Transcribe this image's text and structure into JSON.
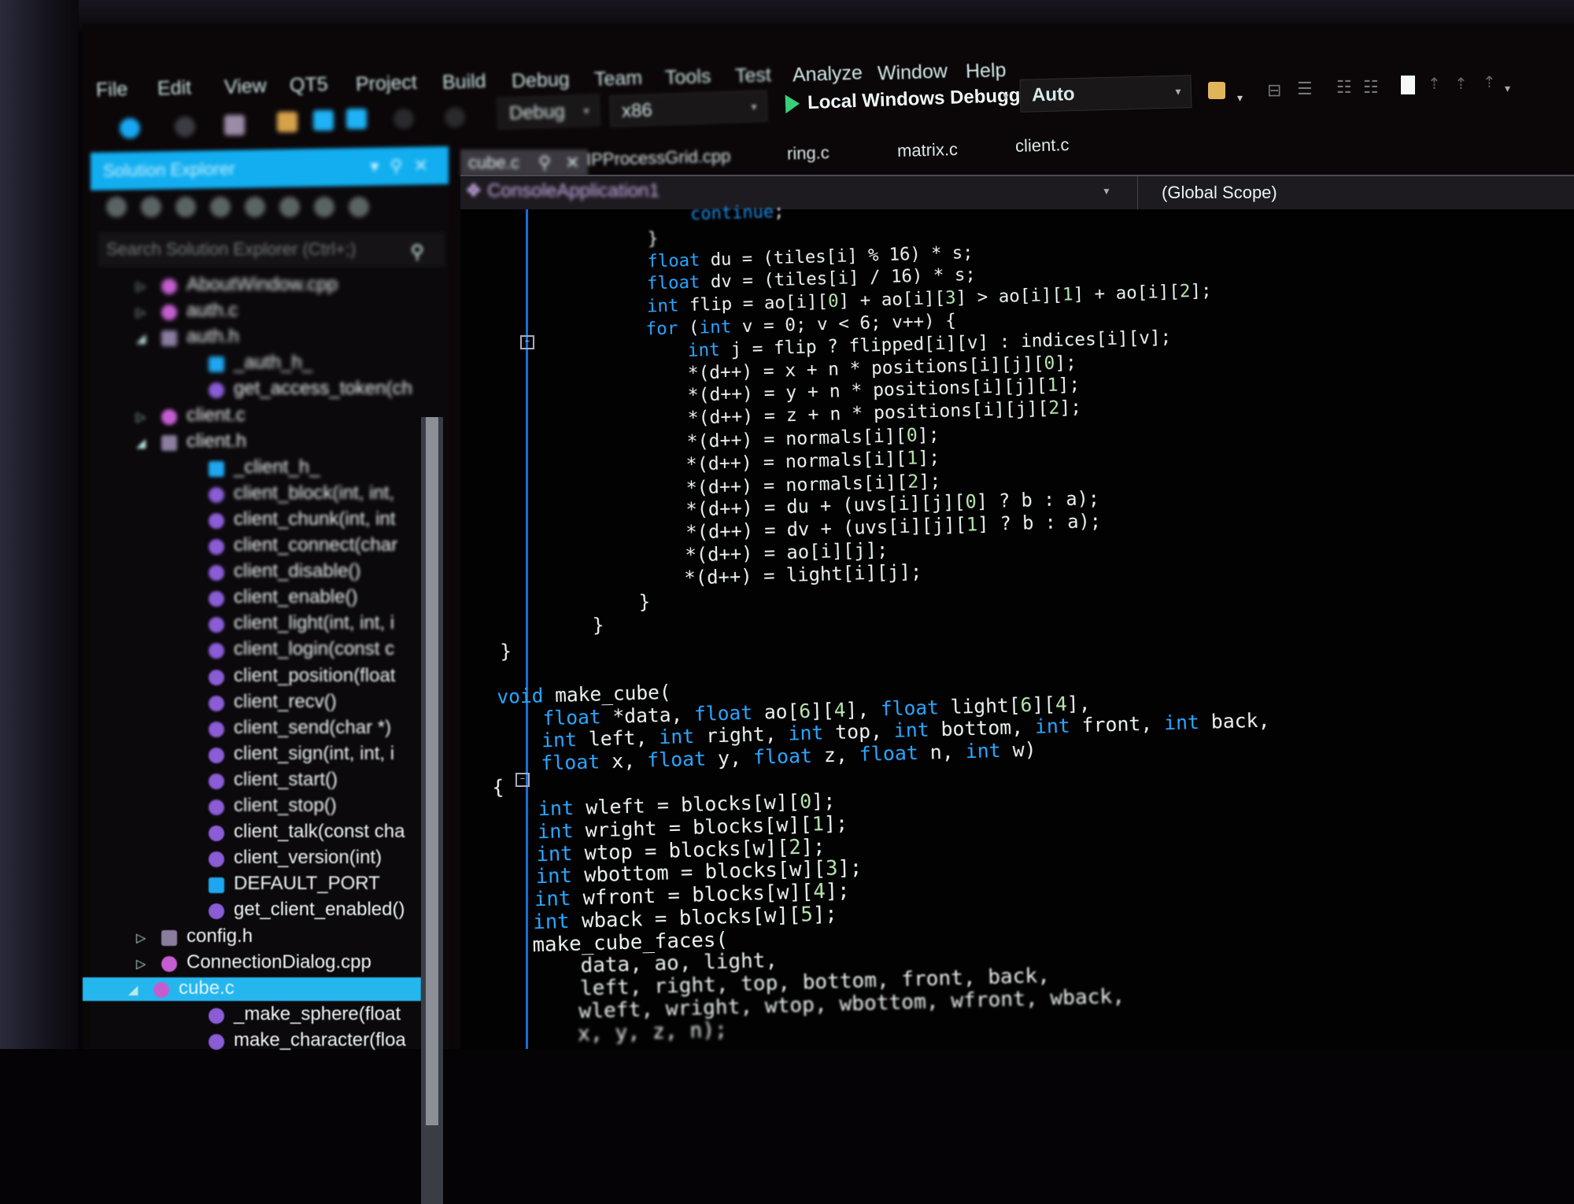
{
  "menu": [
    "File",
    "Edit",
    "View",
    "QT5",
    "Project",
    "Build",
    "Debug",
    "Team",
    "Tools",
    "Test",
    "Analyze",
    "Window",
    "Help"
  ],
  "toolbar": {
    "configuration": "Debug",
    "platform": "x86",
    "run_label": "Local Windows Debugger",
    "run_dropdown": "Auto"
  },
  "solution_explorer": {
    "title": "Solution Explorer",
    "search_placeholder": "Search Solution Explorer (Ctrl+;)",
    "items": [
      {
        "label": "AboutWindow.cpp",
        "kind": "cpp-file",
        "expander": "collapsed",
        "level": 1
      },
      {
        "label": "auth.c",
        "kind": "c-file",
        "expander": "collapsed",
        "level": 1
      },
      {
        "label": "auth.h",
        "kind": "header-file",
        "expander": "expanded",
        "level": 1
      },
      {
        "label": "_auth_h_",
        "kind": "macro",
        "level": 2
      },
      {
        "label": "get_access_token(ch",
        "kind": "function",
        "level": 2
      },
      {
        "label": "client.c",
        "kind": "c-file",
        "expander": "collapsed",
        "level": 1
      },
      {
        "label": "client.h",
        "kind": "header-file",
        "expander": "expanded",
        "level": 1
      },
      {
        "label": "_client_h_",
        "kind": "macro",
        "level": 2
      },
      {
        "label": "client_block(int, int,",
        "kind": "function",
        "level": 2
      },
      {
        "label": "client_chunk(int, int",
        "kind": "function",
        "level": 2
      },
      {
        "label": "client_connect(char",
        "kind": "function",
        "level": 2
      },
      {
        "label": "client_disable()",
        "kind": "function",
        "level": 2
      },
      {
        "label": "client_enable()",
        "kind": "function",
        "level": 2
      },
      {
        "label": "client_light(int, int, i",
        "kind": "function",
        "level": 2
      },
      {
        "label": "client_login(const c",
        "kind": "function",
        "level": 2
      },
      {
        "label": "client_position(float",
        "kind": "function",
        "level": 2
      },
      {
        "label": "client_recv()",
        "kind": "function",
        "level": 2
      },
      {
        "label": "client_send(char *)",
        "kind": "function",
        "level": 2
      },
      {
        "label": "client_sign(int, int, i",
        "kind": "function",
        "level": 2
      },
      {
        "label": "client_start()",
        "kind": "function",
        "level": 2
      },
      {
        "label": "client_stop()",
        "kind": "function",
        "level": 2
      },
      {
        "label": "client_talk(const cha",
        "kind": "function",
        "level": 2
      },
      {
        "label": "client_version(int)",
        "kind": "function",
        "level": 2
      },
      {
        "label": "DEFAULT_PORT",
        "kind": "macro",
        "level": 2
      },
      {
        "label": "get_client_enabled()",
        "kind": "function",
        "level": 2
      },
      {
        "label": "config.h",
        "kind": "header-file",
        "expander": "collapsed",
        "level": 1
      },
      {
        "label": "ConnectionDialog.cpp",
        "kind": "cpp-file",
        "expander": "collapsed",
        "level": 1
      },
      {
        "label": "cube.c",
        "kind": "c-file",
        "expander": "expanded",
        "level": 1,
        "selected": true
      },
      {
        "label": "_make_sphere(float",
        "kind": "function",
        "level": 2
      },
      {
        "label": "make_character(floa",
        "kind": "function",
        "level": 2
      }
    ]
  },
  "editor": {
    "tabs": [
      {
        "label": "cube.c",
        "active": true
      },
      {
        "label": "IPProcessGrid.cpp"
      },
      {
        "label": "ring.c"
      },
      {
        "label": "matrix.c"
      },
      {
        "label": "client.c"
      }
    ],
    "project_scope": "ConsoleApplication1",
    "member_scope": "(Global Scope)",
    "code_lines": [
      "                continue;",
      "            }",
      "            float du = (tiles[i] % 16) * s;",
      "            float dv = (tiles[i] / 16) * s;",
      "            int flip = ao[i][0] + ao[i][3] > ao[i][1] + ao[i][2];",
      "            for (int v = 0; v < 6; v++) {",
      "                int j = flip ? flipped[i][v] : indices[i][v];",
      "                *(d++) = x + n * positions[i][j][0];",
      "                *(d++) = y + n * positions[i][j][1];",
      "                *(d++) = z + n * positions[i][j][2];",
      "                *(d++) = normals[i][0];",
      "                *(d++) = normals[i][1];",
      "                *(d++) = normals[i][2];",
      "                *(d++) = du + (uvs[i][j][0] ? b : a);",
      "                *(d++) = dv + (uvs[i][j][1] ? b : a);",
      "                *(d++) = ao[i][j];",
      "                *(d++) = light[i][j];",
      "            }",
      "        }",
      "}",
      "",
      "void make_cube(",
      "    float *data, float ao[6][4], float light[6][4],",
      "    int left, int right, int top, int bottom, int front, int back,",
      "    float x, float y, float z, float n, int w)",
      "{",
      "    int wleft = blocks[w][0];",
      "    int wright = blocks[w][1];",
      "    int wtop = blocks[w][2];",
      "    int wbottom = blocks[w][3];",
      "    int wfront = blocks[w][4];",
      "    int wback = blocks[w][5];",
      "    make_cube_faces(",
      "        data, ao, light,",
      "        left, right, top, bottom, front, back,",
      "        wleft, wright, wtop, wbottom, wfront, wback,",
      "        x, y, z, n);"
    ]
  },
  "colors": {
    "keyword": "#2aa7ff",
    "text": "#eaf3ef",
    "accent": "#12aef0",
    "selection": "#26b6ee",
    "run_green": "#37d07a"
  }
}
